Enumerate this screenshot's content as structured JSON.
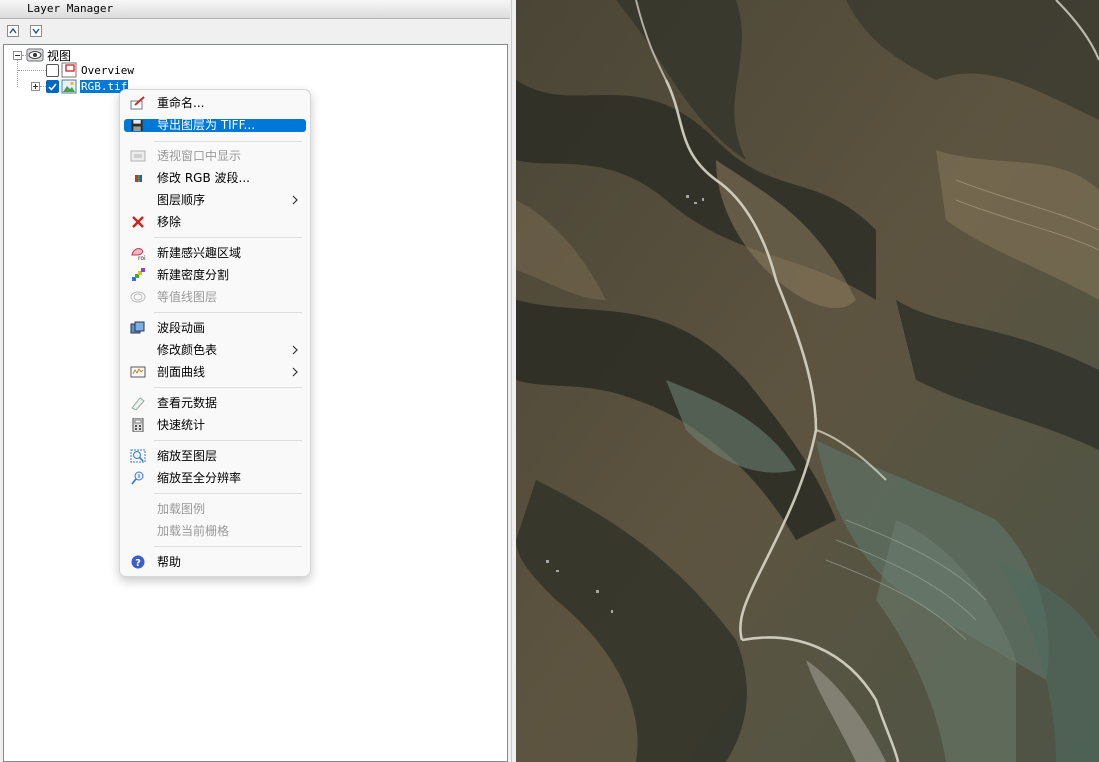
{
  "panel": {
    "title": "Layer Manager",
    "toolbar": {
      "up_icon": "chevron-up-icon",
      "down_icon": "chevron-down-icon"
    }
  },
  "tree": {
    "root_label": "视图",
    "children": [
      {
        "label": "Overview",
        "checked": false,
        "icon": "overview-layer-icon"
      },
      {
        "label": "RGB.tif",
        "checked": true,
        "selected": true,
        "icon": "raster-image-icon"
      }
    ]
  },
  "context_menu": {
    "items": {
      "rename": "重命名...",
      "export_tiff": "导出图层为 TIFF...",
      "show_in_view": "透视窗口中显示",
      "edit_rgb": "修改 RGB 波段...",
      "layer_order": "图层顺序",
      "remove": "移除",
      "new_roi": "新建感兴趣区域",
      "density_slice": "新建密度分割",
      "contour_layer": "等值线图层",
      "band_animation": "波段动画",
      "edit_color_table": "修改颜色表",
      "profile_curve": "剖面曲线",
      "view_metadata": "查看元数据",
      "quick_stats": "快速统计",
      "zoom_to_layer": "缩放至图层",
      "zoom_full_res": "缩放至全分辨率",
      "load_legend": "加载图例",
      "load_current_raster": "加载当前栅格",
      "help": "帮助"
    },
    "icons_text": {
      "roi_icon_text": "roi"
    },
    "highlight_color": "#0078d7",
    "disabled_color": "#9a9a9a"
  },
  "image": {
    "description_icon": "satellite-image"
  }
}
